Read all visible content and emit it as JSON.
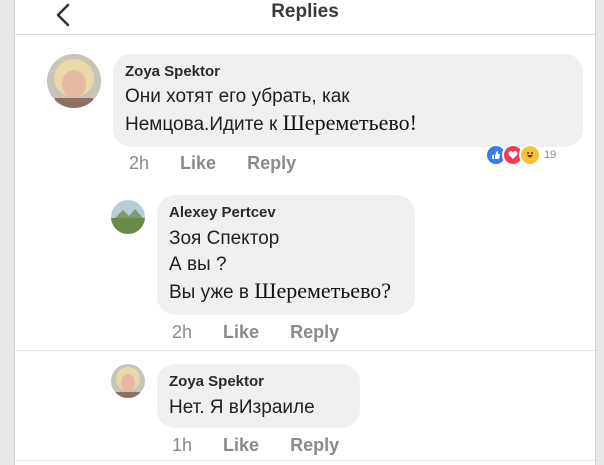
{
  "header": {
    "title": "Replies"
  },
  "comments": [
    {
      "author": "Zoya Spektor",
      "text_line1": "Они хотят его убрать, как",
      "text_line2_a": "Немцова.Идите к ",
      "text_line2_b": "Шереметьево!",
      "time": "2h",
      "like": "Like",
      "reply": "Reply",
      "reactions": {
        "count": "19",
        "icons": [
          "like-icon",
          "love-icon",
          "haha-icon"
        ]
      }
    },
    {
      "author": "Alexey Pertcev",
      "text_line1": "Зоя Спектор",
      "text_line2": "А вы ?",
      "text_line3_a": "Вы уже в ",
      "text_line3_b": "Шереметьево?",
      "time": "2h",
      "like": "Like",
      "reply": "Reply"
    },
    {
      "author": "Zoya Spektor",
      "text_line1": "Нет. Я вИзраиле",
      "time": "1h",
      "like": "Like",
      "reply": "Reply"
    }
  ],
  "colors": {
    "like_blue": "#3b7ce8",
    "love_red": "#ef3d55",
    "haha_yellow": "#f6c03d",
    "bubble": "#eff0f2"
  }
}
